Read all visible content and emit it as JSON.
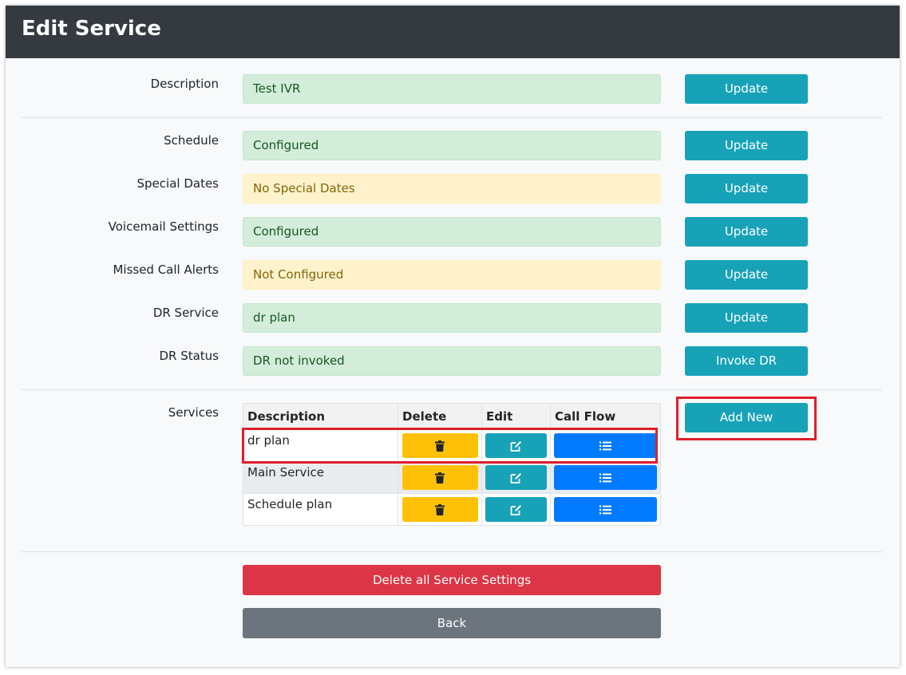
{
  "header": {
    "title": "Edit Service"
  },
  "description": {
    "label": "Description",
    "value": "Test IVR",
    "button": "Update"
  },
  "settings": [
    {
      "label": "Schedule",
      "value": "Configured",
      "status": "ok",
      "button": "Update"
    },
    {
      "label": "Special Dates",
      "value": "No Special Dates",
      "status": "warn",
      "button": "Update"
    },
    {
      "label": "Voicemail Settings",
      "value": "Configured",
      "status": "ok",
      "button": "Update"
    },
    {
      "label": "Missed Call Alerts",
      "value": "Not Configured",
      "status": "warn",
      "button": "Update"
    },
    {
      "label": "DR Service",
      "value": "dr plan",
      "status": "ok",
      "button": "Update"
    },
    {
      "label": "DR Status",
      "value": "DR not invoked",
      "status": "ok",
      "button": "Invoke DR"
    }
  ],
  "services": {
    "label": "Services",
    "add_button": "Add New",
    "columns": [
      "Description",
      "Delete",
      "Edit",
      "Call Flow"
    ],
    "rows": [
      {
        "description": "dr plan"
      },
      {
        "description": "Main Service"
      },
      {
        "description": "Schedule plan"
      }
    ],
    "icons": {
      "delete": "trash-icon",
      "edit": "edit-icon",
      "call_flow": "list-icon"
    }
  },
  "footer": {
    "delete_all": "Delete all Service Settings",
    "back": "Back"
  },
  "colors": {
    "header": "#343a40",
    "info": "#17a2b8",
    "warning": "#ffc107",
    "primary": "#007bff",
    "danger": "#dc3545",
    "secondary": "#6c757d",
    "highlight": "#e01e2b"
  }
}
